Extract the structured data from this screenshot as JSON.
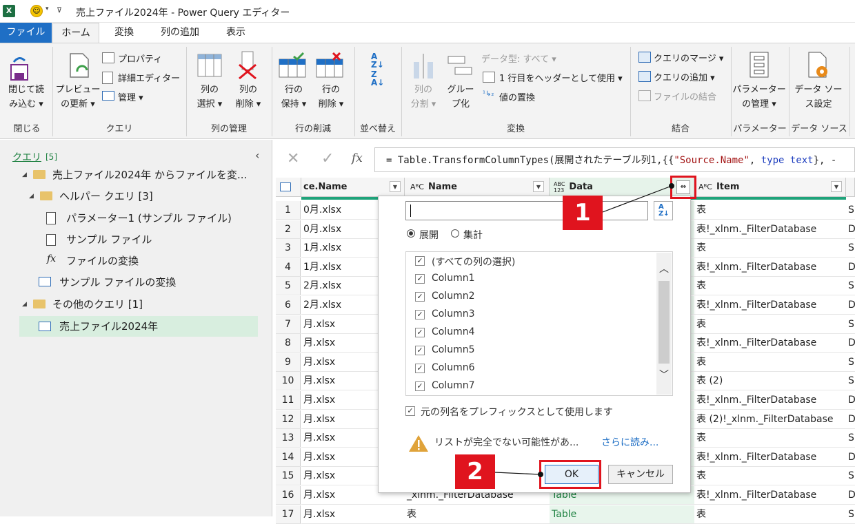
{
  "window": {
    "title": "売上ファイル2024年 - Power Query エディター",
    "app_icon": "X"
  },
  "tabs": [
    "ファイル",
    "ホーム",
    "変換",
    "列の追加",
    "表示"
  ],
  "ribbon": {
    "close_load": "閉じて読\nみ込む ▾",
    "preview_refresh": "プレビュー\nの更新 ▾",
    "properties": "プロパティ",
    "advanced_editor": "詳細エディター",
    "manage": "管理 ▾",
    "choose_cols": "列の\n選択 ▾",
    "remove_cols": "列の\n削除 ▾",
    "keep_rows": "行の\n保持 ▾",
    "remove_rows": "行の\n削除 ▾",
    "split_col": "列の\n分割 ▾",
    "group_by": "グルー\nプ化",
    "data_type": "データ型: すべて ▾",
    "first_row_header": "1 行目をヘッダーとして使用 ▾",
    "replace_values": "値の置換",
    "merge_queries": "クエリのマージ ▾",
    "append_queries": "クエリの追加 ▾",
    "combine_files": "ファイルの結合",
    "manage_params": "パラメーター\nの管理 ▾",
    "data_source_settings": "データ ソー\nス設定",
    "groups": [
      "閉じる",
      "クエリ",
      "列の管理",
      "行の削減",
      "並べ替え",
      "変換",
      "結合",
      "パラメーター",
      "データ ソース"
    ]
  },
  "queries_pane": {
    "header": "クエリ",
    "count": "[5]",
    "items": [
      "売上ファイル2024年 からファイルを変...",
      "ヘルパー クエリ [3]",
      "パラメーター1 (サンプル ファイル)",
      "サンプル ファイル",
      "ファイルの変換",
      "サンプル ファイルの変換",
      "その他のクエリ [1]",
      "売上ファイル2024年"
    ]
  },
  "formula": {
    "fx": "fx",
    "pre": "= Table.TransformColumnTypes(展開されたテーブル列1,{{",
    "s1": "\"Source.Name\"",
    "mid": ", ",
    "kw": "type text",
    "post": "}, -"
  },
  "columns": [
    "ce.Name",
    "Name",
    "Data",
    "Item"
  ],
  "col_types": {
    "name": "AᴮC",
    "data_top": "ABC",
    "data_bot": "123",
    "item": "AᴮC"
  },
  "rows": {
    "nums": [
      "1",
      "2",
      "3",
      "4",
      "5",
      "6",
      "7",
      "8",
      "9",
      "10",
      "11",
      "12",
      "13",
      "14",
      "15",
      "16",
      "17"
    ],
    "source": [
      "0月.xlsx",
      "0月.xlsx",
      "1月.xlsx",
      "1月.xlsx",
      "2月.xlsx",
      "2月.xlsx",
      "月.xlsx",
      "月.xlsx",
      "月.xlsx",
      "月.xlsx",
      "月.xlsx",
      "月.xlsx",
      "月.xlsx",
      "月.xlsx",
      "月.xlsx",
      "月.xlsx",
      "月.xlsx"
    ],
    "item": [
      "表",
      "表!_xlnm._FilterDatabase",
      "表",
      "表!_xlnm._FilterDatabase",
      "表",
      "表!_xlnm._FilterDatabase",
      "表",
      "表!_xlnm._FilterDatabase",
      "表",
      "表 (2)",
      "表!_xlnm._FilterDatabase",
      "表 (2)!_xlnm._FilterDatabase",
      "表",
      "表!_xlnm._FilterDatabase",
      "表",
      "表!_xlnm._FilterDatabase",
      "表"
    ],
    "edge": [
      "S",
      "D",
      "S",
      "D",
      "S",
      "D",
      "S",
      "D",
      "S",
      "S",
      "D",
      "D",
      "S",
      "D",
      "S",
      "D",
      "S"
    ],
    "row16_name": "_xlnm._FilterDatabase",
    "row16_data": "Table",
    "row17_name": "表",
    "row17_data": "Table"
  },
  "popup": {
    "expand": "展開",
    "aggregate": "集計",
    "list": [
      "(すべての列の選択)",
      "Column1",
      "Column2",
      "Column3",
      "Column4",
      "Column5",
      "Column6",
      "Column7"
    ],
    "prefix": "元の列名をプレフィックスとして使用します",
    "warning": "リストが完全でない可能性があ...",
    "more": "さらに読み...",
    "ok": "OK",
    "cancel": "キャンセル"
  },
  "annotations": {
    "one": "1",
    "two": "2"
  },
  "colors": {
    "accent": "#1f6fc5",
    "red": "#e0141e",
    "green": "#1d8040"
  }
}
